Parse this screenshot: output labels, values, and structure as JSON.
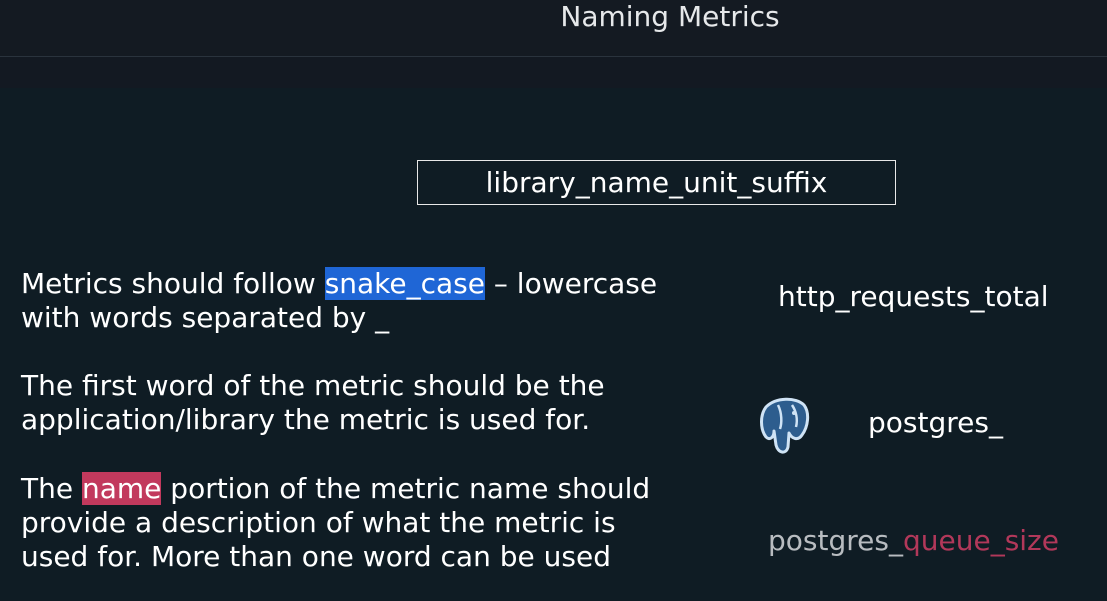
{
  "header": {
    "title": "Naming Metrics"
  },
  "formula": "library_name_unit_suffix",
  "paragraphs": {
    "p1": {
      "before": "Metrics should follow ",
      "highlight": "snake_case",
      "after": " – lowercase",
      "line2": "with words separated by _"
    },
    "p2": {
      "line1": "The first word of the metric should be the",
      "line2": "application/library the metric is used for."
    },
    "p3": {
      "before": "The ",
      "highlight": "name",
      "after": " portion of the metric name should",
      "line2": "provide a description of what the metric is",
      "line3": "used for. More than one word can be used"
    }
  },
  "examples": {
    "ex1": "http_requests_total",
    "ex2": "postgres_",
    "ex3_prefix": "postgres_",
    "ex3_accent": "queue_size"
  },
  "icons": {
    "postgres": "postgresql-elephant-icon"
  },
  "colors": {
    "background": "#0f1c24",
    "header_bg": "#141a22",
    "highlight_blue": "#1f66d6",
    "highlight_red": "#c2395d",
    "accent_text": "#b2385a"
  }
}
